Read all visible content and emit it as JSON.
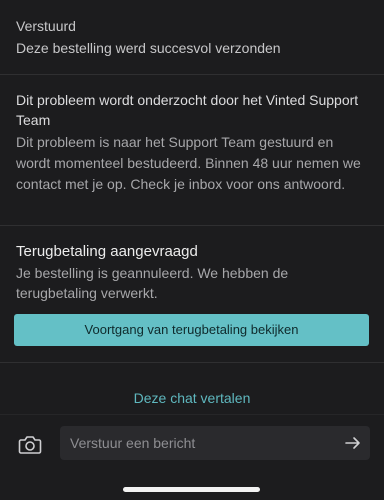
{
  "status_sent": {
    "title": "Verstuurd",
    "body": "Deze bestelling werd succesvol verzonden"
  },
  "investigation": {
    "title": "Dit probleem wordt onderzocht door het Vinted Support Team",
    "body": "Dit probleem is naar het Support Team gestuurd en wordt momenteel bestudeerd. Binnen 48 uur nemen we contact met je op. Check je inbox voor ons antwoord."
  },
  "refund": {
    "title": "Terugbetaling aangevraagd",
    "body": "Je bestelling is geannuleerd. We hebben de terugbetaling verwerkt.",
    "button_label": "Voortgang van terugbetaling bekijken"
  },
  "translate_label": "Deze chat vertalen",
  "composer": {
    "placeholder": "Verstuur een bericht",
    "camera_icon": "camera-icon",
    "send_icon": "arrow-right-icon"
  },
  "colors": {
    "background": "#1c1c1e",
    "accent": "#64c0c6",
    "link": "#5fb8bf"
  }
}
